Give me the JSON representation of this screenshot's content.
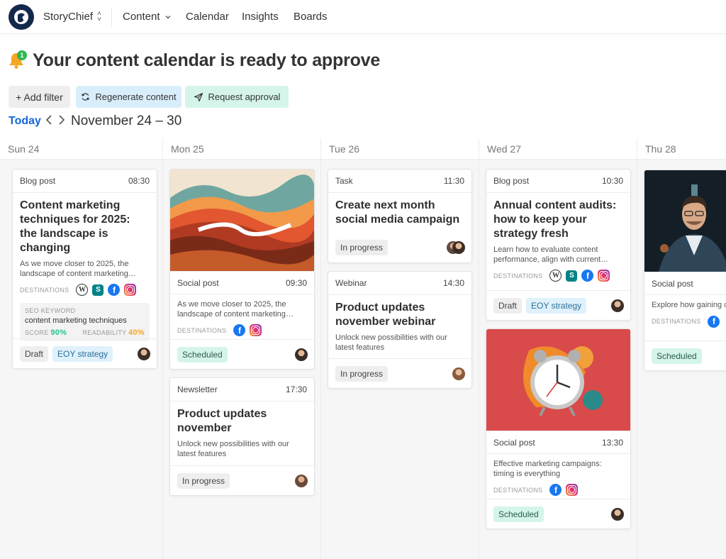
{
  "nav": {
    "workspace": "StoryChief",
    "items": [
      {
        "label": "Content"
      },
      {
        "label": "Calendar"
      },
      {
        "label": "Insights"
      },
      {
        "label": "Boards"
      }
    ]
  },
  "header": {
    "notification_count": "1",
    "title": "Your content calendar is ready to approve",
    "add_filter": "+ Add filter",
    "regenerate": "Regenerate content",
    "request_approval": "Request approval",
    "today": "Today",
    "range": "November 24 – 30"
  },
  "days": [
    "Sun 24",
    "Mon 25",
    "Tue 26",
    "Wed 27",
    "Thu 28"
  ],
  "labels": {
    "destinations": "DESTINATIONS",
    "seo_keyword": "SEO KEYWORD",
    "score": "SCORE",
    "readability": "READABILITY"
  },
  "cards": {
    "sun_blog": {
      "type": "Blog post",
      "time": "08:30",
      "title": "Content marketing techniques for 2025: the landscape is changing",
      "desc": "As we move closer to 2025, the landscape of content marketing…",
      "seo_keyword": "content marketing techniques",
      "score": "90%",
      "readability": "40%",
      "status": "Draft",
      "tag": "EOY strategy"
    },
    "mon_social": {
      "type": "Social post",
      "time": "09:30",
      "desc": "As we move closer to 2025, the landscape of content marketing…",
      "status": "Scheduled"
    },
    "mon_newsletter": {
      "type": "Newsletter",
      "time": "17:30",
      "title": "Product updates november",
      "desc": "Unlock new possibilities with our latest features",
      "status": "In progress"
    },
    "tue_task": {
      "type": "Task",
      "time": "11:30",
      "title": "Create next month social media campaign",
      "status": "In progress"
    },
    "tue_webinar": {
      "type": "Webinar",
      "time": "14:30",
      "title": "Product updates november webinar",
      "desc": "Unlock new possibilities with our latest features",
      "status": "In progress"
    },
    "wed_blog": {
      "type": "Blog post",
      "time": "10:30",
      "title": "Annual content audits: how to keep your strategy fresh",
      "desc": "Learn how to evaluate content performance, align with current…",
      "status": "Draft",
      "tag": "EOY strategy"
    },
    "wed_social": {
      "type": "Social post",
      "time": "13:30",
      "desc": "Effective marketing campaigns: timing is everything",
      "status": "Scheduled"
    },
    "thu_social": {
      "type": "Social post",
      "desc": "Explore how gaining customer insights ca",
      "status": "Scheduled"
    }
  },
  "icons": [
    "wordpress-icon",
    "sharepoint-icon",
    "facebook-icon",
    "instagram-icon"
  ],
  "colors": {
    "accent": "#1565d8",
    "scheduled": "#d5f5ea",
    "tag": "#dff1fb",
    "score": "#27c28b",
    "readability": "#f5a623"
  }
}
